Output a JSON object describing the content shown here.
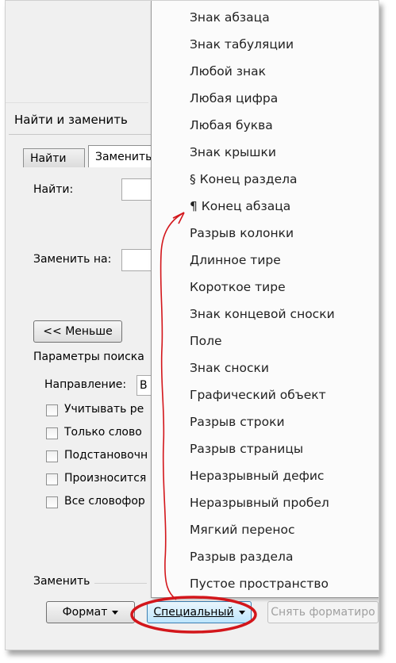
{
  "dialog": {
    "title": "Найти и заменить",
    "tabs": {
      "find": "Найти",
      "replace": "Заменить"
    },
    "find_label": "Найти:",
    "replace_label": "Заменить на:",
    "less_button": "<< Меньше",
    "search_params_label": "Параметры поиска",
    "direction_label": "Направление:",
    "direction_value": "В",
    "checkboxes": [
      {
        "label": "Учитывать ре"
      },
      {
        "label": "Только слово"
      },
      {
        "label": "Подстановочн"
      },
      {
        "label": "Произносится"
      },
      {
        "label": "Все словофор"
      }
    ],
    "replace_section_label": "Заменить",
    "format_button": "Формат",
    "special_button": "Специальный",
    "no_format_button": "Снять форматиро"
  },
  "special_menu": {
    "items": [
      "Знак абзаца",
      "Знак табуляции",
      "Любой знак",
      "Любая цифра",
      "Любая буква",
      "Знак крышки",
      "§ Конец раздела",
      "¶ Конец абзаца",
      "Разрыв колонки",
      "Длинное тире",
      "Короткое тире",
      "Знак концевой сноски",
      "Поле",
      "Знак сноски",
      "Графический объект",
      "Разрыв строки",
      "Разрыв страницы",
      "Неразрывный дефис",
      "Неразрывный пробел",
      "Мягкий перенос",
      "Разрыв раздела",
      "Пустое пространство"
    ]
  },
  "colors": {
    "annotation": "#d3161b",
    "menu_bg": "#fbfbfb",
    "dialog_bg": "#f0f0f0"
  }
}
